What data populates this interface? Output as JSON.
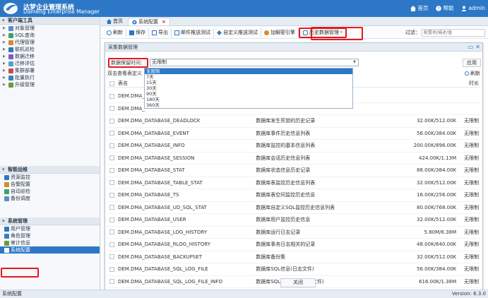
{
  "header": {
    "brand_cn": "达梦企业管理系统",
    "brand_en": "Dameng Enterprise Manager",
    "home": "首页",
    "help": "帮助",
    "user": "admin",
    "bg_color": "#2c78c6"
  },
  "sidebar": {
    "sections": [
      {
        "title": "客户端工具",
        "items": [
          "对象管理",
          "SQL查询",
          "代理管理",
          "联机巡检",
          "数据迁移",
          "迁移评估",
          "集群部署",
          "批量执行",
          "升级管理"
        ]
      },
      {
        "title": "智能运维",
        "items": [
          "资源监控",
          "告警配置",
          "自动巡检",
          "备份调度"
        ]
      },
      {
        "title": "系统管理",
        "items": [
          "用户管理",
          "角色管理",
          "审计信息",
          "系统配置"
        ]
      }
    ],
    "active_item": "系统配置"
  },
  "tabs": [
    {
      "label": "首页"
    },
    {
      "label": "系统配置"
    }
  ],
  "toolbar": {
    "buttons": [
      "刷新",
      "保存",
      "导出",
      "邮件推送测试",
      "自定义推送测试",
      "加解密引擎",
      "历史数据管理"
    ],
    "filter_label": "过滤：",
    "filter_placeholder": "配置项/描述/值"
  },
  "dialog": {
    "title": "采集数据管理",
    "retention_label": "数据保留时间：",
    "retention_value": "无限制",
    "apply_label": "应用",
    "options": [
      "无限制",
      "7天",
      "15天",
      "30天",
      "90天",
      "180天",
      "360天"
    ],
    "hint": "双击查看表定义",
    "refresh": "刷新",
    "col_name": "表名",
    "col_limit": "时长",
    "rows": [
      {
        "name": "DEM.DMA_",
        "desc": "",
        "size": "",
        "limit": ""
      },
      {
        "name": "DEM.DMA_",
        "desc": "",
        "size": "",
        "limit": ""
      },
      {
        "name": "DEM.DMA_DATABASE_DEADLOCK",
        "desc": "数据库发生死锁的历史记录",
        "size": "32.00K/512.00K",
        "limit": "无限制"
      },
      {
        "name": "DEM.DMA_DATABASE_EVENT",
        "desc": "数据库事件历史信息列表",
        "size": "56.00K/384.00K",
        "limit": "无限制"
      },
      {
        "name": "DEM.DMA_DATABASE_INFO",
        "desc": "数据库监控的基本信息列表",
        "size": "200.00K/896.00K",
        "limit": "无限制"
      },
      {
        "name": "DEM.DMA_DATABASE_SESSION",
        "desc": "数据库会话历史信息列表",
        "size": "424.00K/1.13M",
        "limit": "无限制"
      },
      {
        "name": "DEM.DMA_DATABASE_STAT",
        "desc": "数据库状态信息历史记录",
        "size": "88.00K/384.00K",
        "limit": "无限制"
      },
      {
        "name": "DEM.DMA_DATABASE_TABLE_STAT",
        "desc": "数据库表监控历史信息列表",
        "size": "32.00K/512.00K",
        "limit": "无限制"
      },
      {
        "name": "DEM.DMA_DATABASE_TS",
        "desc": "数据库表空间监控历史信息",
        "size": "16.00K/256.00K",
        "limit": "无限制"
      },
      {
        "name": "DEM.DMA_DATABASE_UD_SQL_STAT",
        "desc": "数据库自定义SQL监控历史信息列表",
        "size": "80.00K/768.00K",
        "limit": "无限制"
      },
      {
        "name": "DEM.DMA_DATABASE_USER",
        "desc": "数据库用户监控历史信息",
        "size": "32.00K/512.00K",
        "limit": "无限制"
      },
      {
        "name": "DEM.DMA_DATABASE_LOG_HISTORY",
        "desc": "数据库运行日志记录",
        "size": "5.80M/6.38M",
        "limit": "无限制"
      },
      {
        "name": "DEM.DMA_DATABASE_RLOG_HISTORY",
        "desc": "数据库事务日志相关的记录",
        "size": "48.00K/640.00K",
        "limit": "无限制"
      },
      {
        "name": "DEM.DMA_DATABASE_BACKUPSET",
        "desc": "数据库备份集",
        "size": "32.00K/512.00K",
        "limit": "无限制"
      },
      {
        "name": "DEM.DMA_DATABASE_SQL_LOG_FILE",
        "desc": "数据库SQL信息(日志文件)",
        "size": "56.00K/384.00K",
        "limit": "无限制"
      },
      {
        "name": "DEM.DMA_DATABASE_SQL_LOG_FILE_INFO",
        "desc": "数据库SQL统计信息(日志文件)",
        "size": "616.00K/1.38M",
        "limit": "无限制"
      }
    ],
    "close_label": "关闭"
  },
  "status": {
    "left": "系统配置",
    "version": "Version: 6.3.0"
  }
}
